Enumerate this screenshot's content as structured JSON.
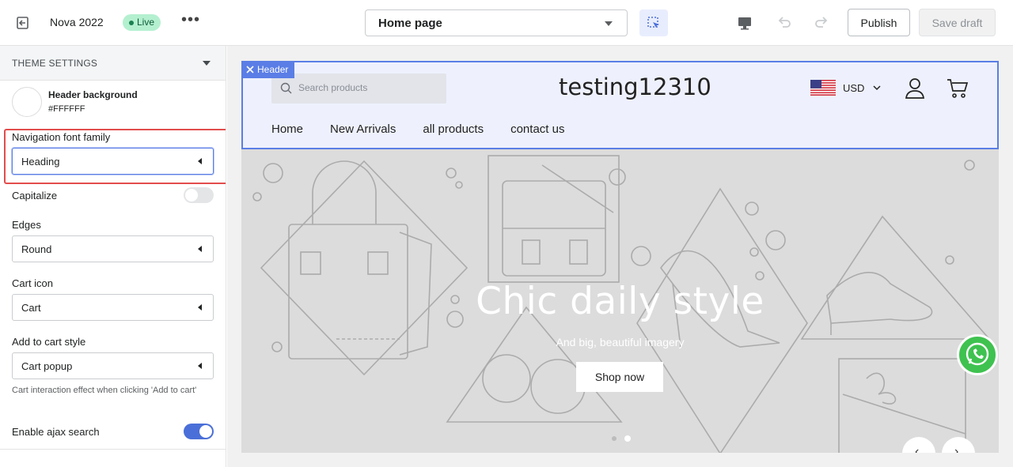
{
  "topbar": {
    "theme_name": "Nova 2022",
    "status": "Live",
    "more": "•••",
    "page_select": "Home page",
    "publish_label": "Publish",
    "save_draft_label": "Save draft"
  },
  "sidebar": {
    "section_title": "THEME SETTINGS",
    "header_background": {
      "label": "Header background",
      "value": "#FFFFFF"
    },
    "nav_font": {
      "label": "Navigation font family",
      "value": "Heading"
    },
    "capitalize": {
      "label": "Capitalize",
      "enabled": false
    },
    "edges": {
      "label": "Edges",
      "value": "Round"
    },
    "cart_icon": {
      "label": "Cart icon",
      "value": "Cart"
    },
    "add_to_cart": {
      "label": "Add to cart style",
      "value": "Cart popup",
      "help": "Cart interaction effect when clicking 'Add to cart'"
    },
    "ajax_search": {
      "label": "Enable ajax search",
      "enabled": true
    }
  },
  "preview": {
    "header_tag": "Header",
    "search_placeholder": "Search products",
    "store_name": "testing12310",
    "currency": "USD",
    "nav": [
      "Home",
      "New Arrivals",
      "all products",
      "contact us"
    ],
    "hero_title": "Chic daily style",
    "hero_subtitle": "And big, beautiful imagery",
    "hero_button": "Shop now",
    "slide_count": 2,
    "active_slide": 2
  },
  "colors": {
    "accent": "#5a7ee6",
    "live_badge": "#b4f0d0",
    "highlight": "#e34c4c",
    "toggle_on": "#4a6fd8",
    "whatsapp": "#3fc250"
  },
  "icons": [
    "exit-icon",
    "inspect-icon",
    "desktop-icon",
    "undo-icon",
    "redo-icon",
    "search-icon",
    "us-flag-icon",
    "account-icon",
    "cart-icon",
    "whatsapp-icon",
    "close-icon"
  ]
}
